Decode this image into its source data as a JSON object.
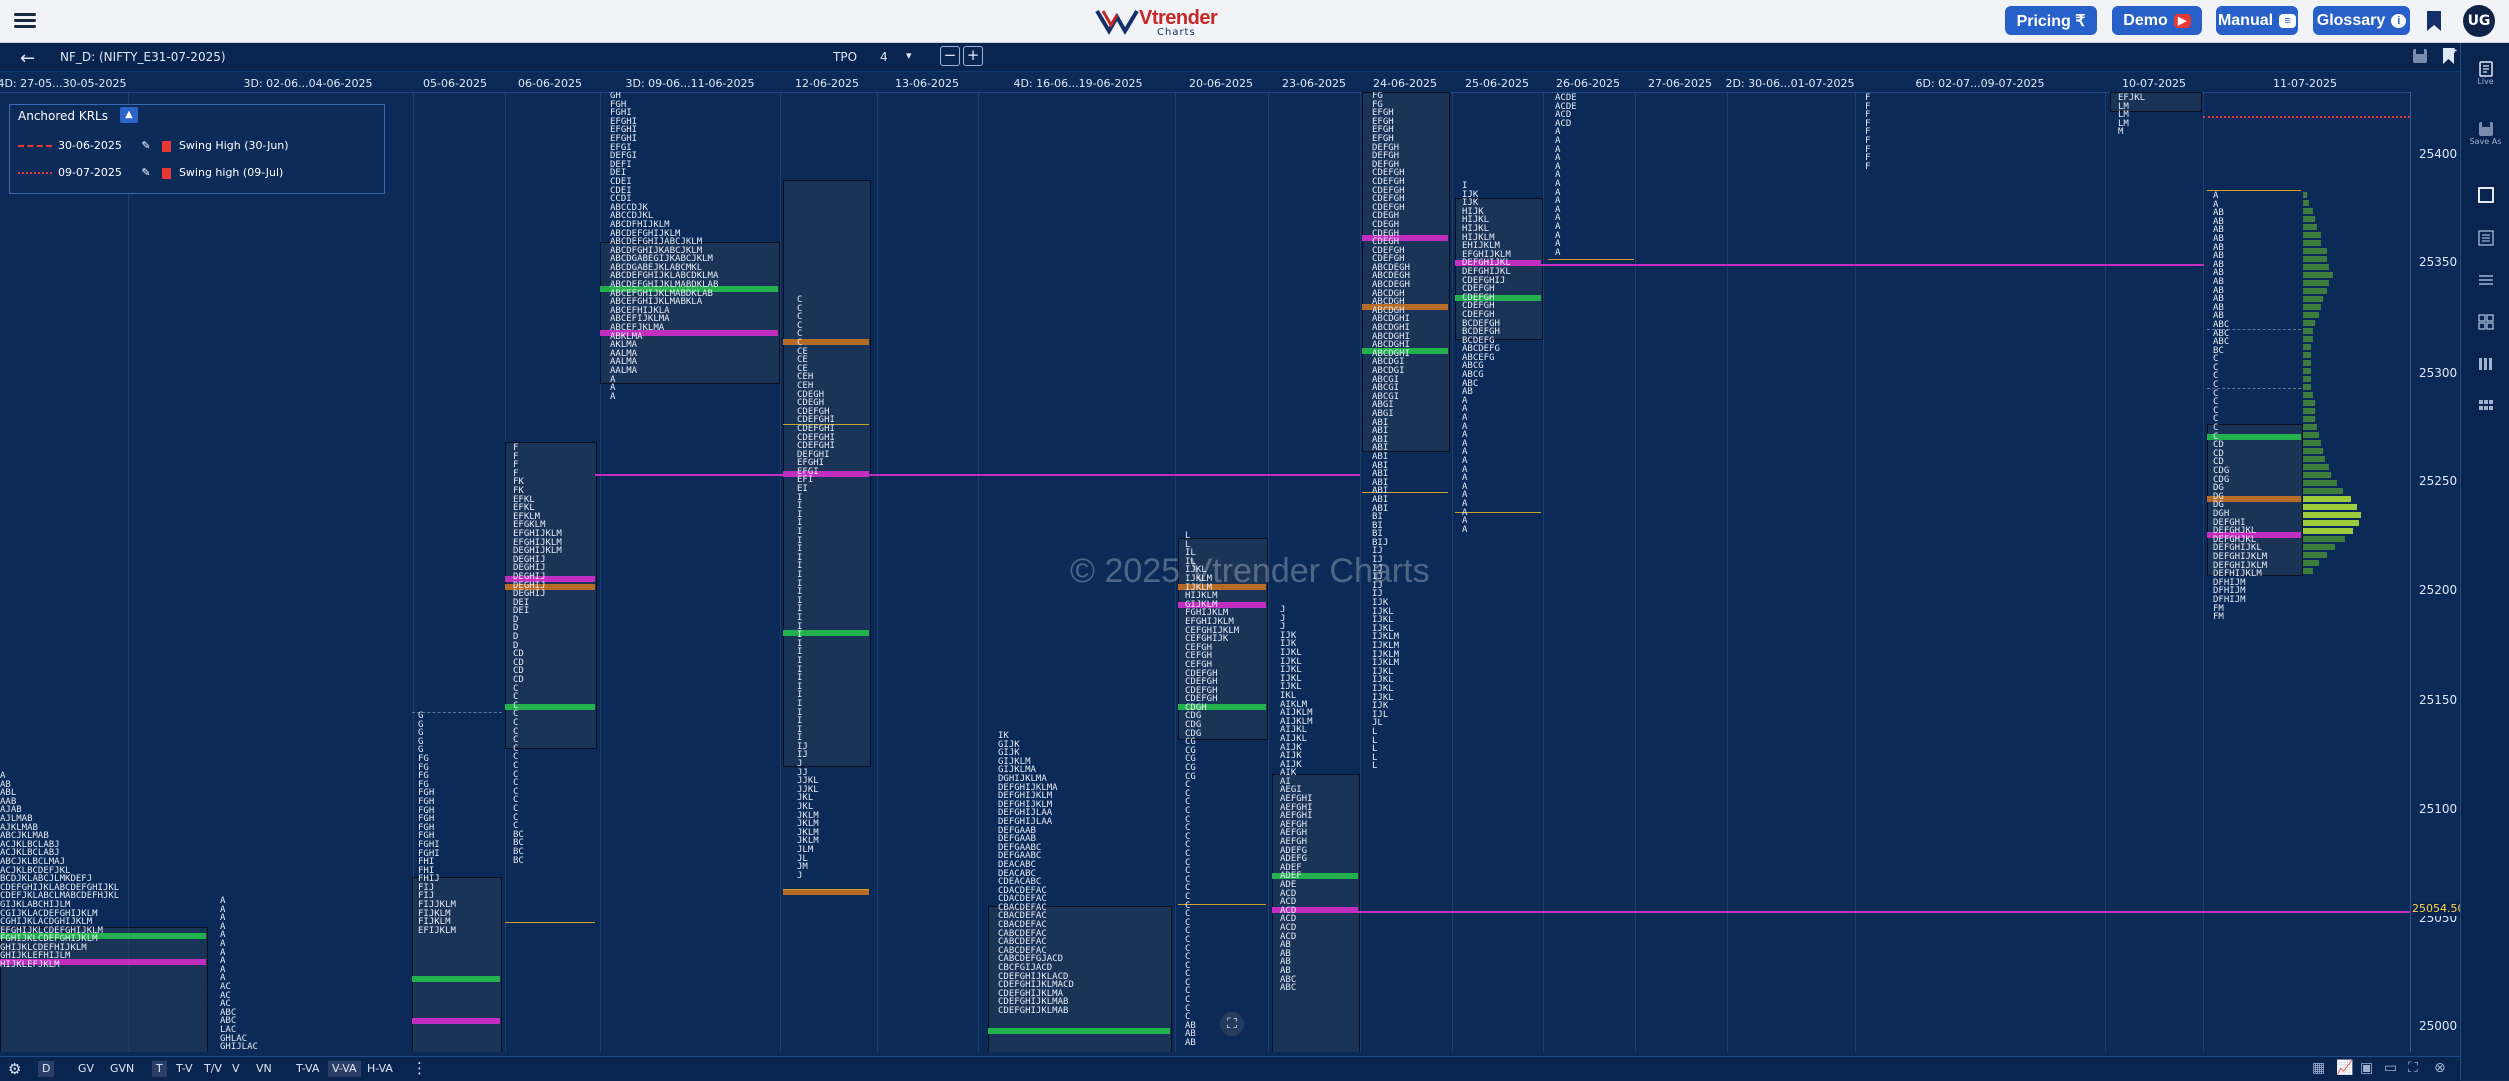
{
  "header": {
    "logo_text": "Vtrender",
    "logo_sub": "Charts",
    "buttons": {
      "pricing": "Pricing ₹",
      "demo": "Demo",
      "manual": "Manual",
      "glossary": "Glossary"
    },
    "avatar_initials": "UG"
  },
  "toolbar": {
    "symbol": "NF_D: (NIFTY_E31-07-2025)",
    "tpo_label": "TPO",
    "tpo_value": "4"
  },
  "date_labels": [
    "4D: 27-05...30-05-2025",
    "3D: 02-06...04-06-2025",
    "05-06-2025",
    "06-06-2025",
    "3D: 09-06...11-06-2025",
    "12-06-2025",
    "13-06-2025",
    "4D: 16-06...19-06-2025",
    "20-06-2025",
    "23-06-2025",
    "24-06-2025",
    "25-06-2025",
    "26-06-2025",
    "27-06-2025",
    "2D: 30-06...01-07-2025",
    "6D: 02-07...09-07-2025",
    "10-07-2025",
    "11-07-2025"
  ],
  "y_axis": {
    "labels": [
      "25400",
      "25350",
      "25300",
      "25250",
      "25200",
      "25150",
      "25100",
      "25050",
      "25000"
    ],
    "current_price": "25054.50"
  },
  "watermark": "© 2025 Vtrender Charts",
  "krl_panel": {
    "title": "Anchored KRLs",
    "rows": [
      {
        "date": "30-06-2025",
        "label": "Swing High (30-Jun)"
      },
      {
        "date": "09-07-2025",
        "label": "Swing high (09-Jul)"
      }
    ]
  },
  "bottom_bar": [
    "D",
    "GV",
    "GVN",
    "T",
    "T-V",
    "T/V",
    "V",
    "VN",
    "T-VA",
    "V-VA",
    "H-VA"
  ],
  "right_sidebar": {
    "live": "Live",
    "save_as": "Save As"
  },
  "colors": {
    "bg": "#0b2a57",
    "poc": "#c22fc0",
    "va_green": "#22b14c",
    "va_orange": "#b86b24",
    "accent_btn": "#2760c8"
  }
}
